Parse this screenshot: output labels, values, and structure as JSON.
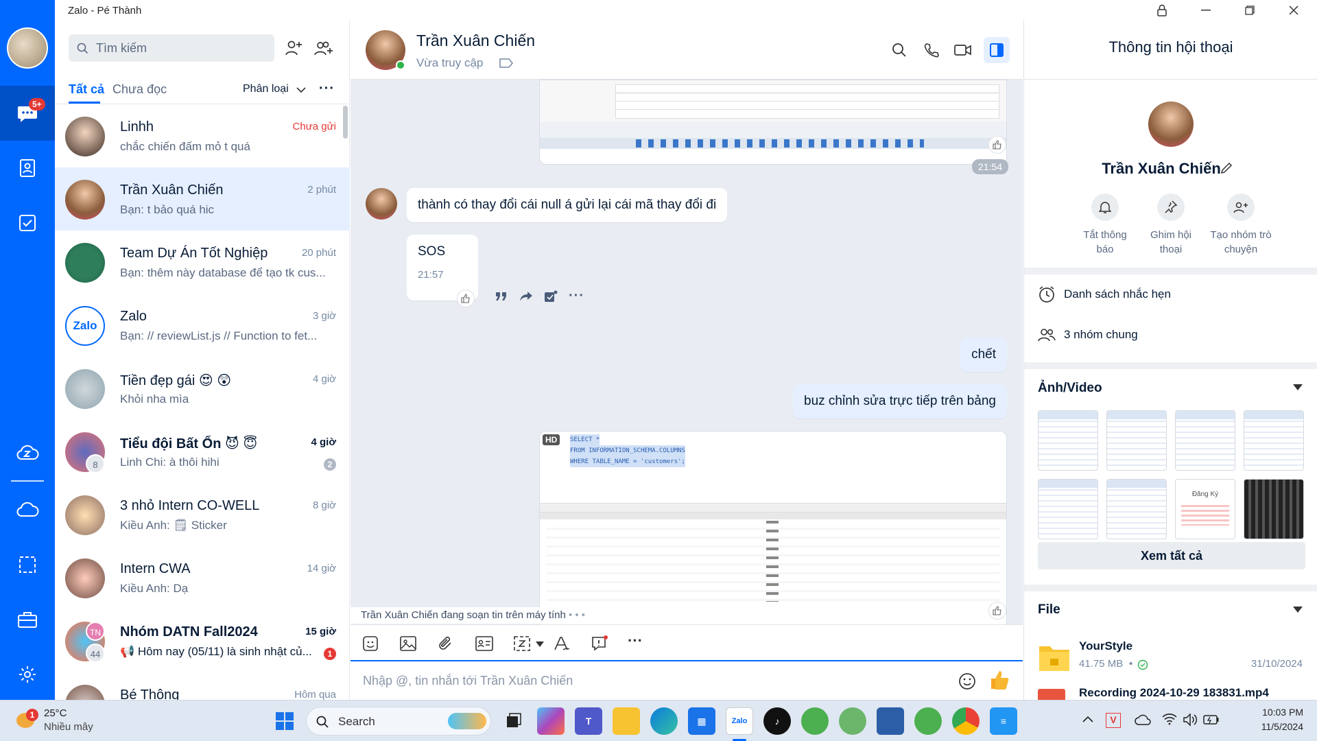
{
  "window": {
    "title": "Zalo - Pé Thành"
  },
  "nav": {
    "badge": "5+"
  },
  "list": {
    "search_placeholder": "Tìm kiếm",
    "tab_all": "Tất cả",
    "tab_unread": "Chưa đọc",
    "classify": "Phân loại",
    "conversations": [
      {
        "name": "Linhh",
        "msg": "chắc chiến đấm mỏ t quá",
        "time": "Chưa gửi"
      },
      {
        "name": "Trần Xuân Chiến",
        "msg": "Bạn: t bảo quá hic",
        "time": "2 phút"
      },
      {
        "name": "Team Dự Án Tốt Nghiệp",
        "msg": "Bạn: thêm này database để tạo tk cus...",
        "time": "20 phút"
      },
      {
        "name": "Zalo",
        "msg": "Bạn: // reviewList.js // Function to fet...",
        "time": "3 giờ"
      },
      {
        "name": "Tiền đẹp gái 😍 😲",
        "msg": "Khỏi nha mìa",
        "time": "4 giờ"
      },
      {
        "name": "Tiểu đội Bất Ổn 😈 😇",
        "msg": "Linh Chi: à thôi hihi",
        "time": "4 giờ",
        "badge": "2",
        "count": "8"
      },
      {
        "name": "3 nhỏ Intern CO-WELL",
        "msg": "Kiều Anh: 🗒 Sticker",
        "time": "8 giờ"
      },
      {
        "name": "Intern CWA",
        "msg": "Kiều Anh: Dạ",
        "time": "14 giờ"
      },
      {
        "name": "Nhóm DATN Fall2024",
        "msg": "📢 Hôm nay (05/11) là sinh nhật củ...",
        "time": "15 giờ",
        "badge": "1",
        "count": "44",
        "initials": "TN"
      },
      {
        "name": "Bé Thông",
        "msg": "",
        "time": "Hôm qua"
      }
    ]
  },
  "chat": {
    "name": "Trần Xuân Chiến",
    "status": "Vừa truy cập",
    "time1": "21:54",
    "msg1": "thành có thay đổi cái null á gửi lại cái mã thay đổi đi",
    "msg2": "SOS",
    "msg2_time": "21:57",
    "msg3": "chết",
    "msg4": "buz chỉnh sửa trực tiếp trên bảng",
    "hd": "HD",
    "typing": "Trần Xuân Chiến đang soạn tin trên máy tính",
    "input_placeholder": "Nhập @, tin nhắn tới Trần Xuân Chiến",
    "sql": [
      "SELECT *",
      "FROM INFORMATION_SCHEMA.COLUMNS",
      "WHERE TABLE_NAME = 'customers';"
    ]
  },
  "info": {
    "title": "Thông tin hội thoại",
    "name": "Trần Xuân Chiến",
    "mute": "Tắt thông báo",
    "pin": "Ghim hội thoại",
    "group": "Tạo nhóm trò chuyện",
    "reminders": "Danh sách nhắc hẹn",
    "common_groups": "3 nhóm chung",
    "media_title": "Ảnh/Video",
    "see_all": "Xem tất cả",
    "file_title": "File",
    "file1_name": "YourStyle",
    "file1_size": "41.75 MB",
    "file1_date": "31/10/2024",
    "file2_name": "Recording 2024-10-29 183831.mp4",
    "thumb_text": "Đăng Ký"
  },
  "taskbar": {
    "temp": "25°C",
    "weather": "Nhiều mây",
    "weather_badge": "1",
    "search": "Search",
    "time": "10:03 PM",
    "date": "11/5/2024"
  }
}
